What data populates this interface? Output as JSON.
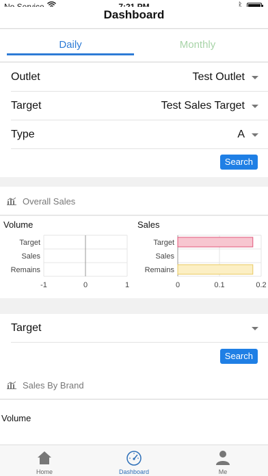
{
  "status": {
    "carrier": "No Service",
    "time": "7:21 PM"
  },
  "nav": {
    "title": "Dashboard"
  },
  "tabs": [
    {
      "label": "Daily",
      "active": true
    },
    {
      "label": "Monthly",
      "active": false
    }
  ],
  "filters": {
    "outlet": {
      "label": "Outlet",
      "value": "Test Outlet"
    },
    "target": {
      "label": "Target",
      "value": "Test Sales Target"
    },
    "type": {
      "label": "Type",
      "value": "A"
    },
    "search_label": "Search"
  },
  "overall_sales": {
    "heading": "Overall Sales"
  },
  "chart_data": [
    {
      "type": "bar",
      "title": "Volume",
      "orientation": "horizontal",
      "categories": [
        "Target",
        "Sales",
        "Remains"
      ],
      "values": [
        0,
        0,
        0
      ],
      "xlim": [
        -1,
        1
      ],
      "xticks": [
        "-1",
        "0",
        "1"
      ],
      "grid": true
    },
    {
      "type": "bar",
      "title": "Sales",
      "orientation": "horizontal",
      "categories": [
        "Target",
        "Sales",
        "Remains"
      ],
      "values": [
        0.18,
        0,
        0.18
      ],
      "colors": [
        "#f7c6d0",
        "#ffffff",
        "#fcefc4"
      ],
      "xlim": [
        0,
        0.2
      ],
      "xticks": [
        "0",
        "0.1",
        "0.2"
      ],
      "grid": true
    }
  ],
  "target_filter": {
    "label": "Target",
    "value": "",
    "search_label": "Search"
  },
  "sales_by_brand": {
    "heading": "Sales By Brand",
    "volume_label": "Volume"
  },
  "bottom_nav": [
    {
      "label": "Home",
      "icon": "home-icon"
    },
    {
      "label": "Dashboard",
      "icon": "speedometer-icon",
      "active": true
    },
    {
      "label": "Me",
      "icon": "person-icon"
    }
  ],
  "colors": {
    "accent": "#2d7bd6",
    "button": "#1f7fe5",
    "target_bar": "#f7c6d0",
    "remains_bar": "#fcefc4"
  }
}
